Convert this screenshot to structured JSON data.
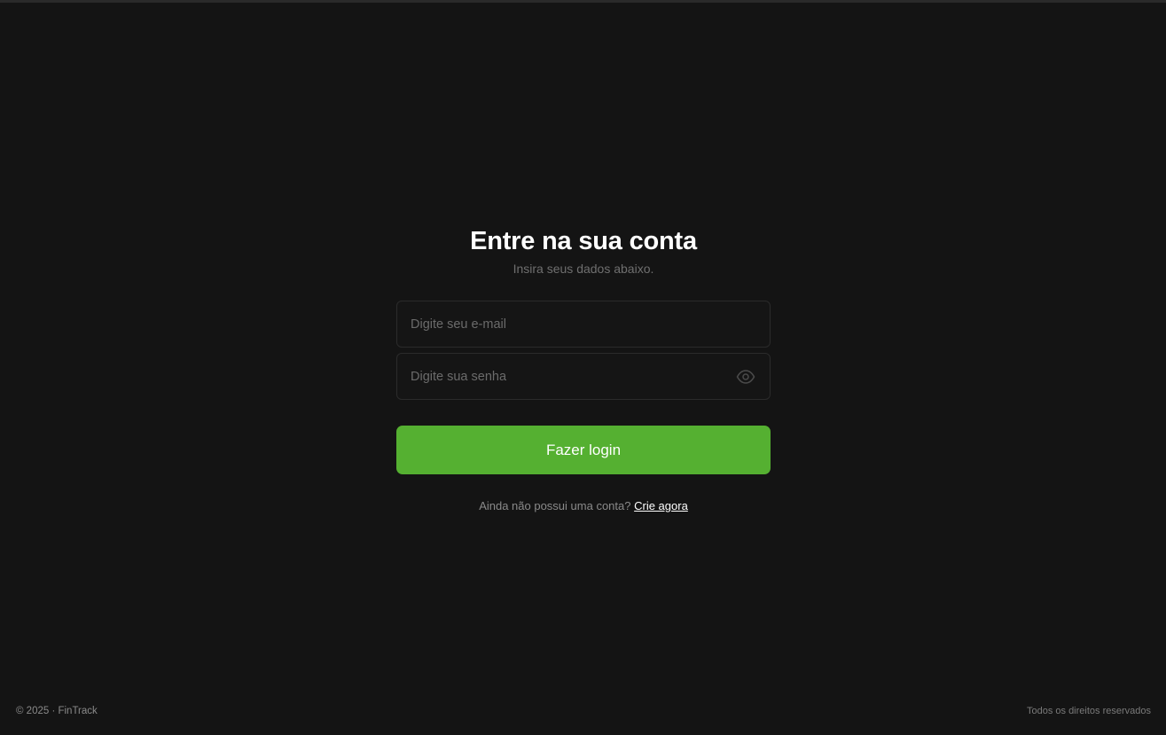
{
  "login": {
    "title": "Entre na sua conta",
    "subtitle": "Insira seus dados abaixo.",
    "email_placeholder": "Digite seu e-mail",
    "password_placeholder": "Digite sua senha",
    "password_toggle_icon": "eye-icon",
    "submit_label": "Fazer login",
    "signup_prompt": "Ainda não possui uma conta?",
    "signup_link": "Crie agora"
  },
  "footer": {
    "copyright": "© 2025 · FinTrack",
    "rights": "Todos os direitos reservados"
  },
  "colors": {
    "background": "#141414",
    "accent": "#55b031",
    "field_border": "#2b2b2b"
  }
}
